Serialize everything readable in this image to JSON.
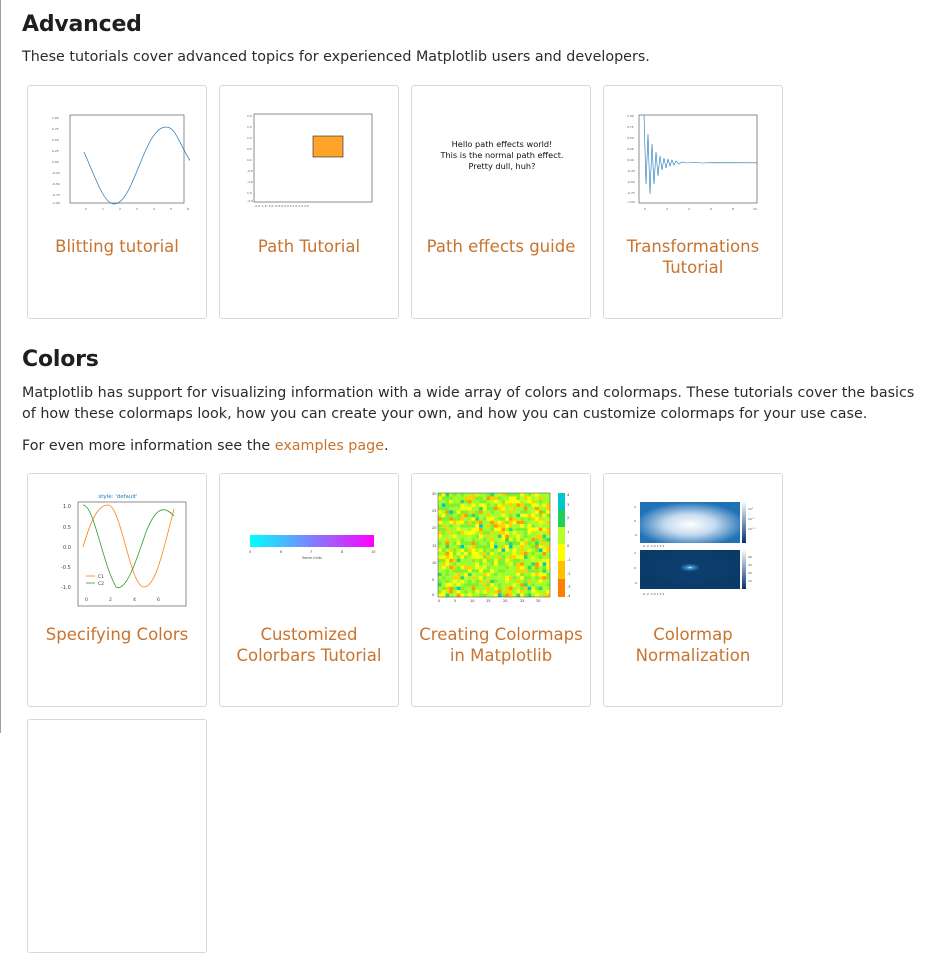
{
  "advanced": {
    "title": "Advanced",
    "description": "These tutorials cover advanced topics for experienced Matplotlib users and developers.",
    "cards": [
      {
        "label": "Blitting tutorial"
      },
      {
        "label": "Path Tutorial"
      },
      {
        "label": "Path effects guide",
        "thumb_lines": [
          "Hello path effects world!",
          "This is the normal path effect.",
          "Pretty dull, huh?"
        ]
      },
      {
        "label": "Transformations Tutorial"
      }
    ]
  },
  "colors": {
    "title": "Colors",
    "description": "Matplotlib has support for visualizing information with a wide array of colors and colormaps. These tutorials cover the basics of how these colormaps look, how you can create your own, and how you can customize colormaps for your use case.",
    "more_prefix": "For even more information see the ",
    "more_link": "examples page",
    "more_suffix": ".",
    "cards": [
      {
        "label": "Specifying Colors",
        "thumb_title": "style: 'default'",
        "legend": [
          "C1",
          "C2"
        ]
      },
      {
        "label": "Customized Colorbars Tutorial",
        "thumb_axis_label": "Some Units"
      },
      {
        "label": "Creating Colormaps in Matplotlib"
      },
      {
        "label": "Colormap Normalization"
      }
    ]
  },
  "colors_theme": {
    "link": "#c8742f",
    "orange": "#ffa32b",
    "blue": "#1f77b4"
  }
}
